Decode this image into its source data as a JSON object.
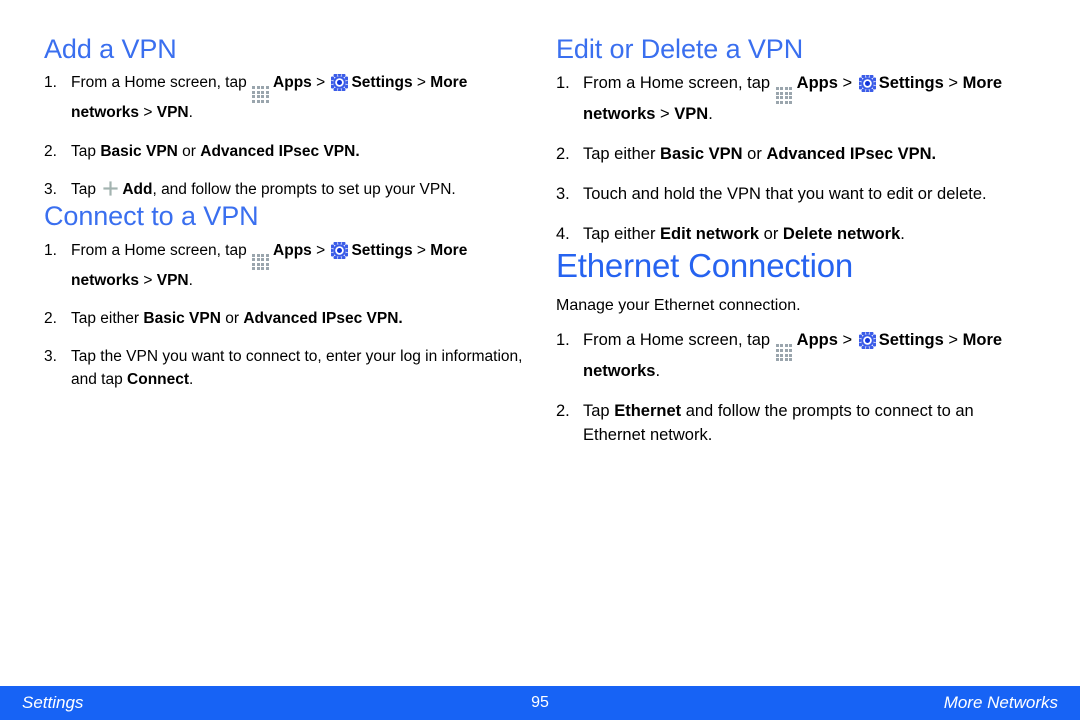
{
  "document": {
    "page_number": "95"
  },
  "icons": {
    "apps": "apps-grid-icon",
    "settings": "settings-gear-icon",
    "add": "plus-add-icon"
  },
  "colors": {
    "heading_blue": "#3a6fef",
    "chapter_blue": "#2663f0",
    "footer_blue": "#1763f5",
    "apps_icon_gray": "#9aa5ad",
    "add_icon_gray": "#a3b3b0"
  },
  "left_column": {
    "sections": [
      {
        "heading": "Add a VPN",
        "steps": [
          {
            "num": "1.",
            "parts": [
              {
                "t": "text",
                "v": "From a Home screen, tap "
              },
              {
                "t": "icon",
                "v": "apps"
              },
              {
                "t": "bold",
                "v": "Apps"
              },
              {
                "t": "text",
                "v": " > "
              },
              {
                "t": "icon",
                "v": "settings"
              },
              {
                "t": "bold",
                "v": "Settings"
              },
              {
                "t": "text",
                "v": " > "
              },
              {
                "t": "bold",
                "v": "More networks"
              },
              {
                "t": "text",
                "v": " > "
              },
              {
                "t": "bold",
                "v": "VPN"
              },
              {
                "t": "text",
                "v": "."
              }
            ]
          },
          {
            "num": "2.",
            "parts": [
              {
                "t": "text",
                "v": "Tap "
              },
              {
                "t": "bold",
                "v": "Basic VPN"
              },
              {
                "t": "text",
                "v": " or "
              },
              {
                "t": "bold",
                "v": "Advanced IPsec VPN."
              }
            ]
          },
          {
            "num": "3.",
            "parts": [
              {
                "t": "text",
                "v": "Tap "
              },
              {
                "t": "icon",
                "v": "add"
              },
              {
                "t": "bold",
                "v": "Add"
              },
              {
                "t": "text",
                "v": ", and follow the prompts to set up your VPN."
              }
            ]
          }
        ]
      },
      {
        "heading": "Connect to a VPN",
        "steps": [
          {
            "num": "1.",
            "parts": [
              {
                "t": "text",
                "v": "From a Home screen, tap "
              },
              {
                "t": "icon",
                "v": "apps"
              },
              {
                "t": "bold",
                "v": "Apps"
              },
              {
                "t": "text",
                "v": " > "
              },
              {
                "t": "icon",
                "v": "settings"
              },
              {
                "t": "bold",
                "v": "Settings"
              },
              {
                "t": "text",
                "v": " > "
              },
              {
                "t": "bold",
                "v": "More networks"
              },
              {
                "t": "text",
                "v": " > "
              },
              {
                "t": "bold",
                "v": "VPN"
              },
              {
                "t": "text",
                "v": "."
              }
            ]
          },
          {
            "num": "2.",
            "parts": [
              {
                "t": "text",
                "v": "Tap either "
              },
              {
                "t": "bold",
                "v": "Basic VPN"
              },
              {
                "t": "text",
                "v": " or "
              },
              {
                "t": "bold",
                "v": "Advanced IPsec VPN."
              }
            ]
          },
          {
            "num": "3.",
            "parts": [
              {
                "t": "text",
                "v": "Tap the VPN you want to connect to, enter your log in information, and tap "
              },
              {
                "t": "bold",
                "v": "Connect"
              },
              {
                "t": "text",
                "v": "."
              }
            ]
          }
        ]
      }
    ]
  },
  "right_column": {
    "sections": [
      {
        "heading": "Edit or Delete a VPN",
        "level": "section",
        "steps": [
          {
            "num": "1.",
            "parts": [
              {
                "t": "text",
                "v": "From a Home screen, tap "
              },
              {
                "t": "icon",
                "v": "apps"
              },
              {
                "t": "bold",
                "v": "Apps"
              },
              {
                "t": "text",
                "v": " > "
              },
              {
                "t": "icon",
                "v": "settings"
              },
              {
                "t": "bold",
                "v": "Settings"
              },
              {
                "t": "text",
                "v": " > "
              },
              {
                "t": "bold",
                "v": "More networks"
              },
              {
                "t": "text",
                "v": " > "
              },
              {
                "t": "bold",
                "v": "VPN"
              },
              {
                "t": "text",
                "v": "."
              }
            ]
          },
          {
            "num": "2.",
            "parts": [
              {
                "t": "text",
                "v": "Tap either "
              },
              {
                "t": "bold",
                "v": "Basic VPN"
              },
              {
                "t": "text",
                "v": " or "
              },
              {
                "t": "bold",
                "v": "Advanced IPsec VPN."
              }
            ]
          },
          {
            "num": "3.",
            "parts": [
              {
                "t": "text",
                "v": "Touch and hold the VPN that you want to edit or delete."
              }
            ]
          },
          {
            "num": "4.",
            "parts": [
              {
                "t": "text",
                "v": "Tap either "
              },
              {
                "t": "bold",
                "v": "Edit network"
              },
              {
                "t": "text",
                "v": " or "
              },
              {
                "t": "bold",
                "v": "Delete network"
              },
              {
                "t": "text",
                "v": "."
              }
            ]
          }
        ]
      },
      {
        "heading": "Ethernet Connection",
        "level": "chapter",
        "intro": "Manage your Ethernet connection.",
        "steps": [
          {
            "num": "1.",
            "parts": [
              {
                "t": "text",
                "v": "From a Home screen, tap "
              },
              {
                "t": "icon",
                "v": "apps"
              },
              {
                "t": "bold",
                "v": "Apps"
              },
              {
                "t": "text",
                "v": " > "
              },
              {
                "t": "icon",
                "v": "settings"
              },
              {
                "t": "bold",
                "v": "Settings"
              },
              {
                "t": "text",
                "v": " > "
              },
              {
                "t": "bold",
                "v": "More networks"
              },
              {
                "t": "text",
                "v": "."
              }
            ]
          },
          {
            "num": "2.",
            "parts": [
              {
                "t": "text",
                "v": "Tap "
              },
              {
                "t": "bold",
                "v": "Ethernet"
              },
              {
                "t": "text",
                "v": " and follow the prompts to connect to an Ethernet network."
              }
            ]
          }
        ]
      }
    ]
  },
  "footer": {
    "left_label": "Settings",
    "center_label": "95",
    "right_label": "More Networks"
  }
}
